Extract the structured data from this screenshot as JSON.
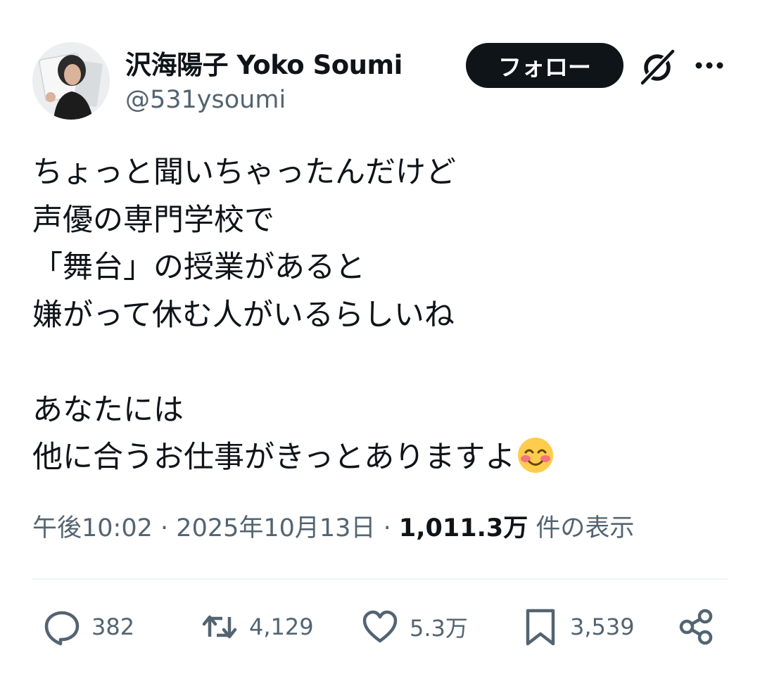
{
  "author": {
    "display_name": "沢海陽子 Yoko Soumi",
    "handle": "@531ysoumi"
  },
  "header": {
    "follow_label": "フォロー",
    "grok_icon": "grok-icon",
    "more_icon": "more-horizontal-icon"
  },
  "tweet": {
    "text": "ちょっと聞いちゃったんだけど\n声優の専門学校で\n「舞台」の授業があると\n嫌がって休む人がいるらしいね\n\nあなたには\n他に合うお仕事がきっとありますよ",
    "emoji": "smiling-face-with-blush"
  },
  "meta": {
    "time": "午後10:02",
    "sep1": "·",
    "date": "2025年10月13日",
    "sep2": "·",
    "views_count": "1,011.3万",
    "views_label": "件の表示"
  },
  "actions": {
    "replies": "382",
    "reposts": "4,129",
    "likes": "5.3万",
    "bookmarks": "3,539"
  },
  "colors": {
    "text": "#0f1419",
    "secondary": "#536471",
    "follow_bg": "#0f1419",
    "follow_text": "#ffffff"
  }
}
